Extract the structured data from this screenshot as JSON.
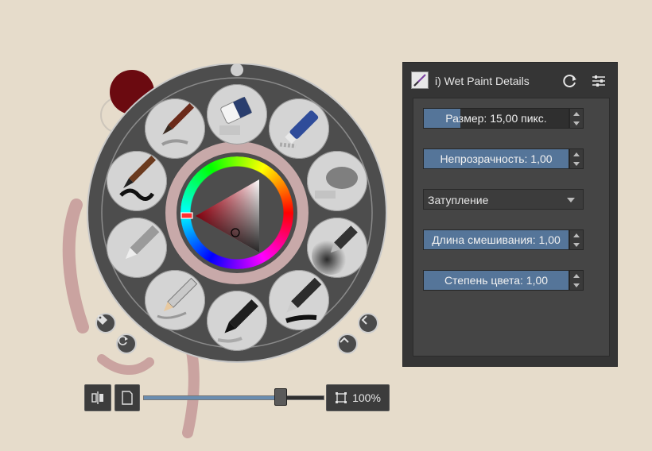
{
  "palette": {
    "fg_color": "#6b0a10",
    "bg_color": "#e6dccb",
    "brushes": [
      {
        "name": "eraser-brush",
        "icon": "eraser-icon"
      },
      {
        "name": "blue-eraser-brush",
        "icon": "eraser-pen-icon"
      },
      {
        "name": "blender-brush",
        "icon": "blender-icon"
      },
      {
        "name": "airbrush-brush",
        "icon": "airbrush-icon"
      },
      {
        "name": "marker-brush",
        "icon": "marker-icon"
      },
      {
        "name": "ink-pen-brush",
        "icon": "ink-pen-icon"
      },
      {
        "name": "pencil-brush",
        "icon": "pencil-icon"
      },
      {
        "name": "fineliner-brush",
        "icon": "fineliner-icon"
      },
      {
        "name": "ink-brush",
        "icon": "ink-brush-icon"
      },
      {
        "name": "paint-brush",
        "icon": "paint-brush-icon"
      }
    ]
  },
  "toolbar": {
    "zoom_label": "100%",
    "zoom_fraction": 0.76
  },
  "docker": {
    "title": "i) Wet Paint Details",
    "size_label": "Размер: 15,00 пикс.",
    "size_fraction": 0.25,
    "opacity_label": "Непрозрачность: 1,00",
    "opacity_fraction": 1.0,
    "smudge_mode": "Затупление",
    "smudge_length_label": "Длина смешивания: 1,00",
    "smudge_length_fraction": 1.0,
    "color_rate_label": "Степень цвета: 1,00",
    "color_rate_fraction": 1.0
  }
}
